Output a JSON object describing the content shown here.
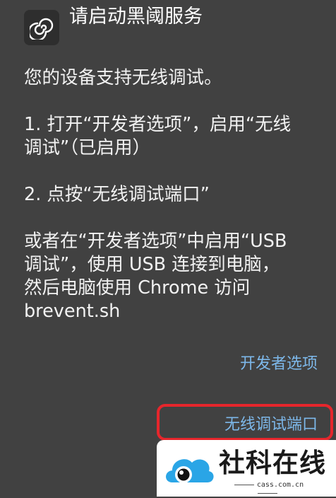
{
  "dialog": {
    "title": "请启动黑阈服务",
    "icon": "brevent-spiral-icon",
    "paragraphs": [
      "您的设备支持无线调试。",
      "1. 打开“开发者选项”，启用“无线\n调试”（已启用）",
      "2. 点按“无线调试端口”",
      "或者在“开发者选项”中启用“USB\n调试”，使用 USB 连接到电脑，\n然后电脑使用 Chrome 访问\nbrevent.sh"
    ],
    "actions": {
      "developer_options": "开发者选项",
      "wireless_debug_port": "无线调试端口"
    }
  },
  "colors": {
    "background": "#414141",
    "link": "#7db8ea",
    "highlight": "#e6262c"
  },
  "watermark": {
    "title": "社科在线",
    "subtitle": "cass.com.cn"
  }
}
